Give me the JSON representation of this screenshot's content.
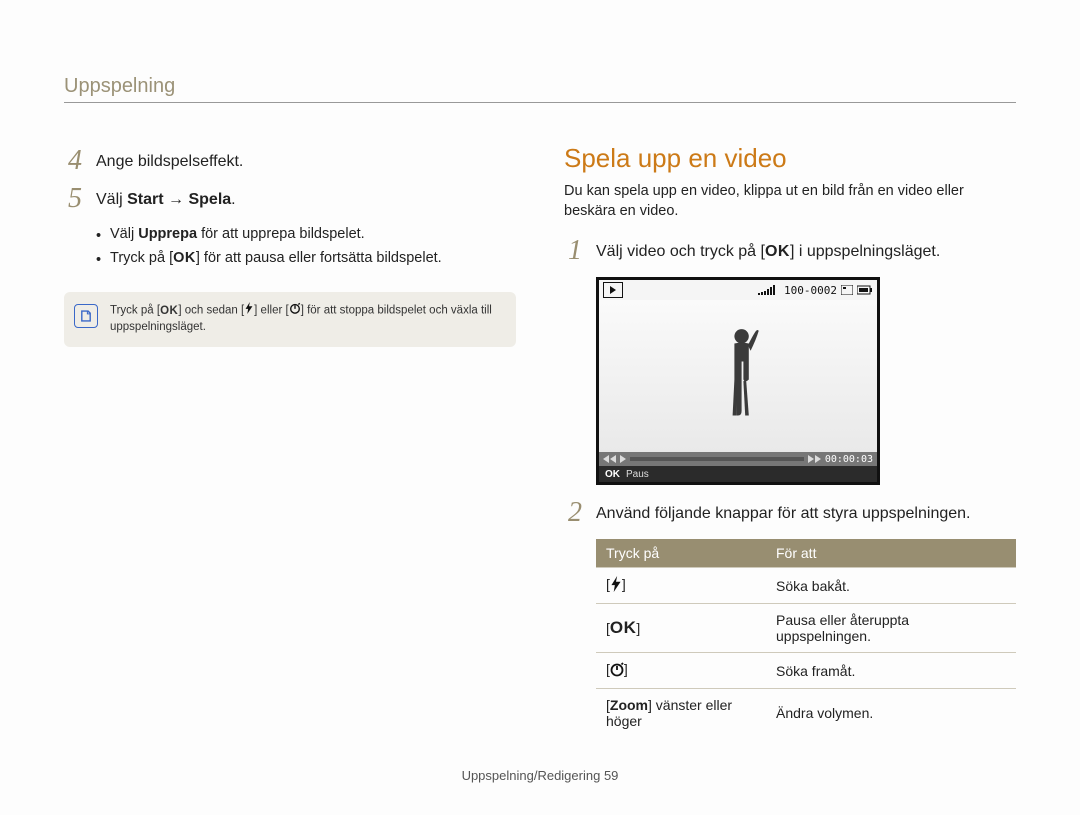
{
  "section_title": "Uppspelning",
  "left": {
    "step4": {
      "num": "4",
      "text": "Ange bildspelseffekt."
    },
    "step5": {
      "num": "5",
      "prefix": "Välj ",
      "bold": "Start → Spela",
      "suffix": "."
    },
    "sub1_a": "Välj ",
    "sub1_b": "Upprepa",
    "sub1_c": " för att upprepa bildspelet.",
    "sub2_a": "Tryck på [",
    "sub2_ok": "OK",
    "sub2_b": "] för att pausa eller fortsätta bildspelet.",
    "note_a": "Tryck på [",
    "note_ok": "OK",
    "note_b": "] och sedan [",
    "note_c": "] eller [",
    "note_d": "] för att stoppa bildspelet och växla till uppspelningsläget."
  },
  "right": {
    "heading": "Spela upp en video",
    "intro": "Du kan spela upp en video, klippa ut en bild från en video eller beskära en video.",
    "step1": {
      "num": "1",
      "a": "Välj video och tryck på [",
      "ok": "OK",
      "b": "] i uppspelningsläget."
    },
    "frame": {
      "counter": "100-0002",
      "time": "00:00:03",
      "ok": "OK",
      "paus": "Paus"
    },
    "step2": {
      "num": "2",
      "text": "Använd följande knappar för att styra uppspelningen."
    },
    "table": {
      "h1": "Tryck på",
      "h2": "För att",
      "rows": [
        {
          "key_type": "flash",
          "label_a": "[",
          "label_b": "]",
          "val": "Söka bakåt."
        },
        {
          "key_type": "ok",
          "label_a": "[",
          "ok": "OK",
          "label_b": "]",
          "val": "Pausa eller återuppta uppspelningen."
        },
        {
          "key_type": "timer",
          "label_a": "[",
          "label_b": "]",
          "val": "Söka framåt."
        },
        {
          "key_type": "zoom",
          "zoom_a": "[",
          "zoom_b": "Zoom",
          "zoom_c": "] vänster eller höger",
          "val": "Ändra volymen."
        }
      ]
    }
  },
  "footer": {
    "text": "Uppspelning/Redigering",
    "page": "59"
  }
}
